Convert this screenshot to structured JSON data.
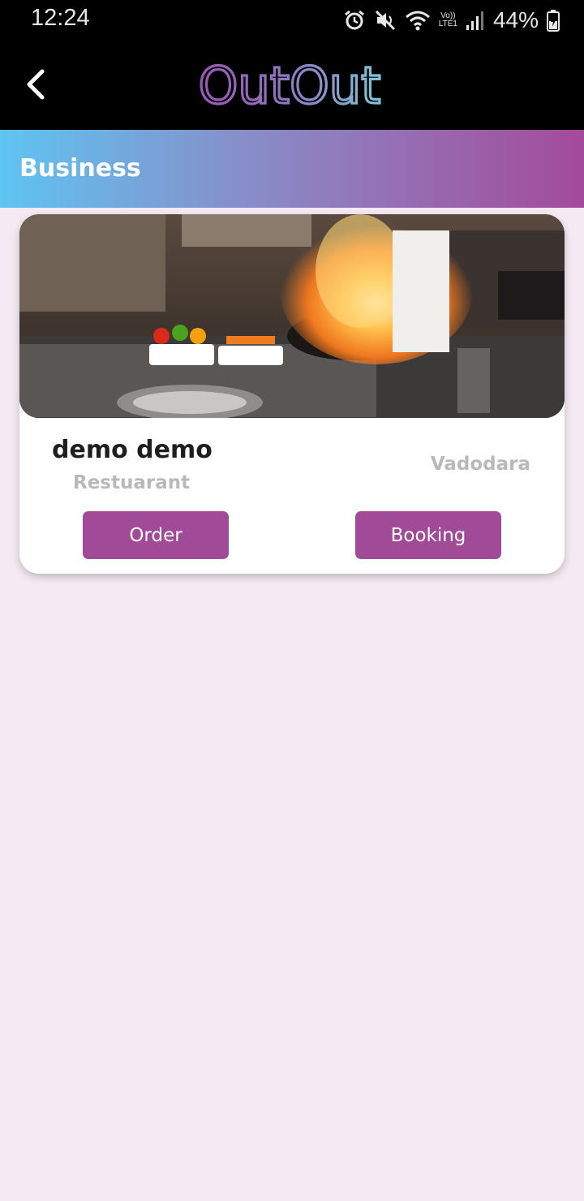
{
  "status_bar": {
    "time": "12:24",
    "battery_percent": "44%",
    "network_label": "LTE1",
    "volte_label": "Vo))",
    "icons": [
      "alarm-icon",
      "mute-icon",
      "wifi-icon",
      "signal-icon",
      "battery-icon"
    ]
  },
  "app_bar": {
    "logo_text": "OutOut",
    "back_icon": "chevron-left-icon"
  },
  "section": {
    "title": "Business"
  },
  "business_card": {
    "image": "kitchen-flambe-photo",
    "name": "demo demo",
    "category": "Restuarant",
    "city": "Vadodara",
    "order_label": "Order",
    "booking_label": "Booking"
  },
  "colors": {
    "background": "#f5eaf3",
    "button": "#a14b98",
    "gradient_start": "#5ec4f2",
    "gradient_end": "#a44a9a"
  }
}
